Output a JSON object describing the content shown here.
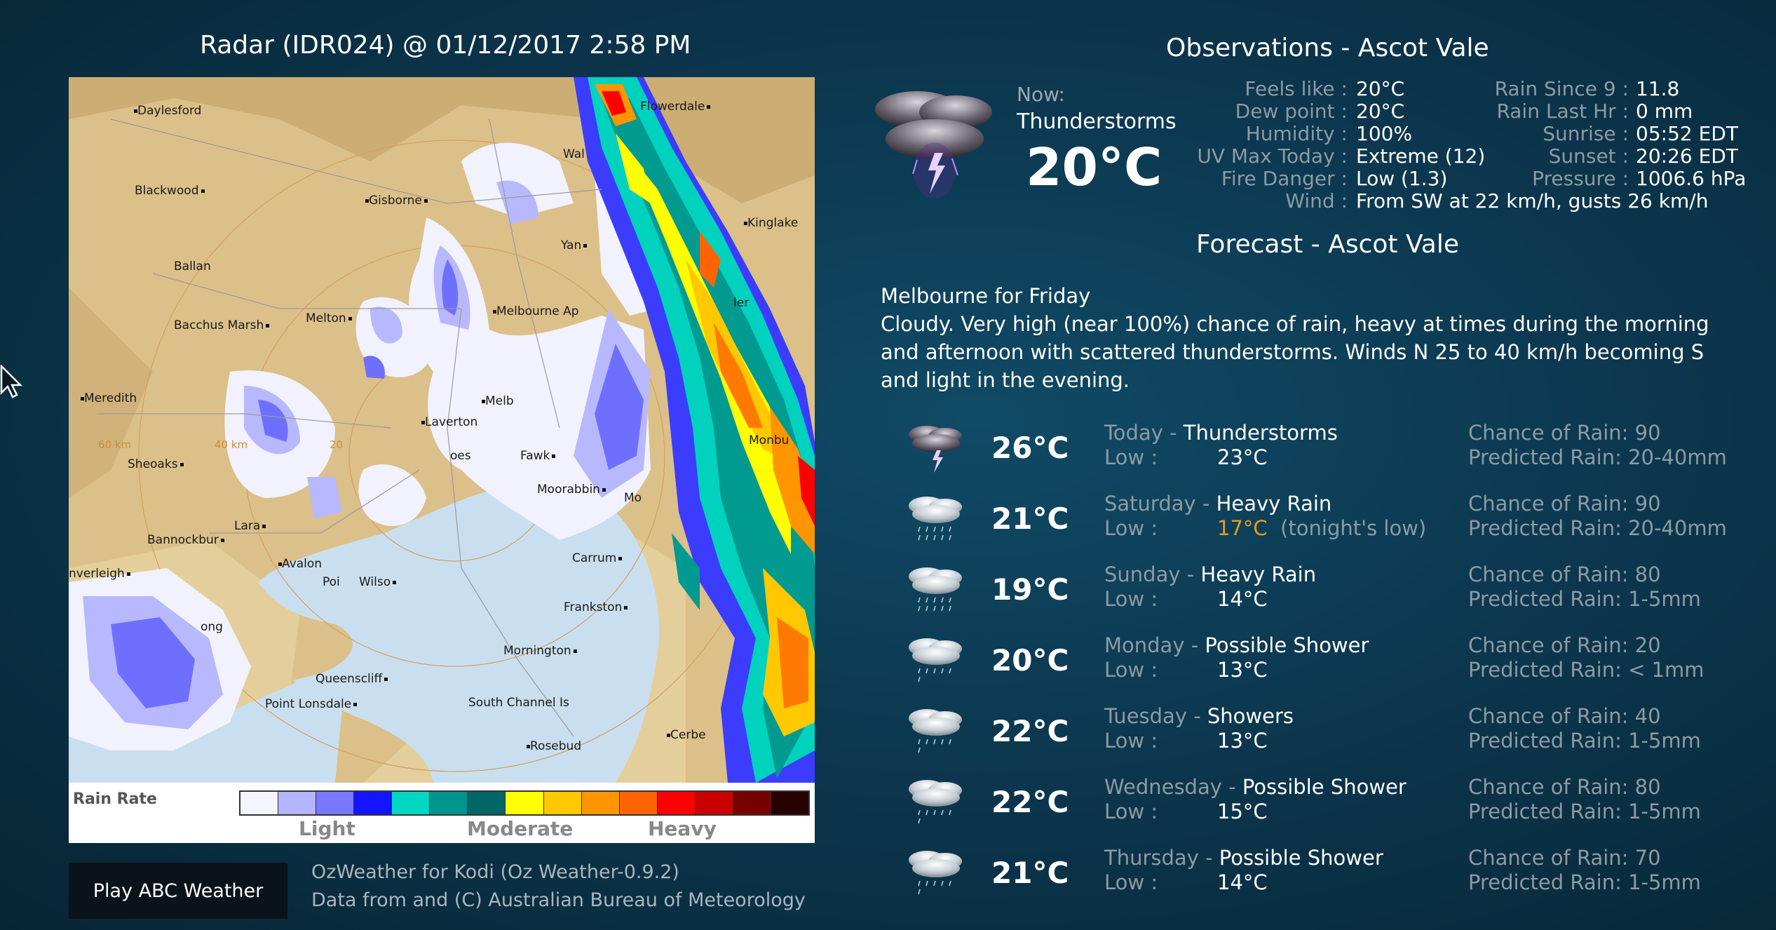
{
  "radar": {
    "title": "Radar (IDR024) @ 01/12/2017 2:58 PM",
    "legend_label": "Rain Rate",
    "levels": [
      "Light",
      "Moderate",
      "Heavy"
    ],
    "scale_colors": [
      "#f5f5ff",
      "#b4b4ff",
      "#7878ff",
      "#1414ff",
      "#00d8c3",
      "#009690",
      "#006666",
      "#ffff00",
      "#ffc800",
      "#ff9600",
      "#ff6400",
      "#ff0000",
      "#c80000",
      "#780000",
      "#280000"
    ],
    "places": {
      "daylesford": "Daylesford",
      "flowerdale": "Flowerdale",
      "blackwood": "Blackwood",
      "gisborne": "Gisborne",
      "wal": "Wal",
      "kinglake": "Kinglake",
      "yan": "Yan",
      "ballan": "Ballan",
      "melbourne_ap": "Melbourne Ap",
      "bacchus_marsh": "Bacchus Marsh",
      "melton": "Melton",
      "ler": "ler",
      "meredith": "Meredith",
      "melb": "Melb",
      "laverton": "Laverton",
      "sheoaks": "Sheoaks",
      "fawkner": "Fawk",
      "monbulk": "Monbu",
      "moorabbin": "Moorabbin",
      "mo": "Mo",
      "lara": "Lara",
      "bannockburn": "Bannockbur",
      "avalon": "Avalon",
      "carrum": "Carrum",
      "inverleigh": "nverleigh",
      "poi": "Poi",
      "wilso": "Wilso",
      "frankston": "Frankston",
      "geelong": "ong",
      "mornington": "Mornington",
      "queenscliff": "Queenscliff",
      "point_lonsdale": "Point Lonsdale",
      "south_channel": "South Channel Is",
      "cerbe": "Cerbe",
      "rosebud": "Rosebud",
      "oes": "oes"
    },
    "ranges": [
      "60 km",
      "40 km",
      "20"
    ]
  },
  "play_button": "Play ABC Weather",
  "credits": {
    "line1": "OzWeather for Kodi (Oz Weather-0.9.2)",
    "line2": "Data from and (C) Australian Bureau of Meteorology"
  },
  "observations": {
    "title": "Observations - Ascot Vale",
    "now_label": "Now:",
    "condition": "Thunderstorms",
    "temperature": "20°C",
    "icon": "thunderstorm-icon",
    "left": [
      {
        "k": "Feels like :",
        "v": "20°C"
      },
      {
        "k": "Dew point :",
        "v": "20°C"
      },
      {
        "k": "Humidity :",
        "v": "100%"
      },
      {
        "k": "UV Max Today :",
        "v": "Extreme (12)"
      },
      {
        "k": "Fire Danger :",
        "v": "Low (1.3)"
      },
      {
        "k": "Wind :",
        "v": "From SW at 22 km/h, gusts 26 km/h"
      }
    ],
    "right": [
      {
        "k": "Rain Since 9 :",
        "v": "11.8"
      },
      {
        "k": "Rain Last Hr :",
        "v": "0 mm"
      },
      {
        "k": "Sunrise :",
        "v": "05:52 EDT"
      },
      {
        "k": "Sunset :",
        "v": "20:26 EDT"
      },
      {
        "k": "Pressure :",
        "v": "1006.6 hPa"
      }
    ]
  },
  "forecast": {
    "title": "Forecast - Ascot Vale",
    "heading": "Melbourne for Friday",
    "text": "Cloudy. Very high (near 100%) chance of rain, heavy at times during the morning and afternoon with scattered thunderstorms. Winds N 25 to 40 km/h becoming S and light in the evening.",
    "low_label": "Low :",
    "days": [
      {
        "day": "Today",
        "cond": "Thunderstorms",
        "hi": "26°C",
        "low": "23°C",
        "low_note": "",
        "chance": "Chance of Rain: 90",
        "pred": "Predicted Rain: 20-40mm",
        "icon": "thunderstorm-icon"
      },
      {
        "day": "Saturday",
        "cond": "Heavy Rain",
        "hi": "21°C",
        "low": "17°C",
        "low_note": "(tonight's low)",
        "chance": "Chance of Rain: 90",
        "pred": "Predicted Rain: 20-40mm",
        "icon": "heavy-rain-icon"
      },
      {
        "day": "Sunday",
        "cond": "Heavy Rain",
        "hi": "19°C",
        "low": "14°C",
        "low_note": "",
        "chance": "Chance of Rain: 80",
        "pred": "Predicted Rain: 1-5mm",
        "icon": "heavy-rain-icon"
      },
      {
        "day": "Monday",
        "cond": "Possible Shower",
        "hi": "20°C",
        "low": "13°C",
        "low_note": "",
        "chance": "Chance of Rain: 20",
        "pred": "Predicted Rain: < 1mm",
        "icon": "shower-icon"
      },
      {
        "day": "Tuesday",
        "cond": "Showers",
        "hi": "22°C",
        "low": "13°C",
        "low_note": "",
        "chance": "Chance of Rain: 40",
        "pred": "Predicted Rain: 1-5mm",
        "icon": "shower-icon"
      },
      {
        "day": "Wednesday",
        "cond": "Possible Shower",
        "hi": "22°C",
        "low": "15°C",
        "low_note": "",
        "chance": "Chance of Rain: 80",
        "pred": "Predicted Rain: 1-5mm",
        "icon": "shower-icon"
      },
      {
        "day": "Thursday",
        "cond": "Possible Shower",
        "hi": "21°C",
        "low": "14°C",
        "low_note": "",
        "chance": "Chance of Rain: 70",
        "pred": "Predicted Rain: 1-5mm",
        "icon": "shower-icon"
      }
    ]
  }
}
